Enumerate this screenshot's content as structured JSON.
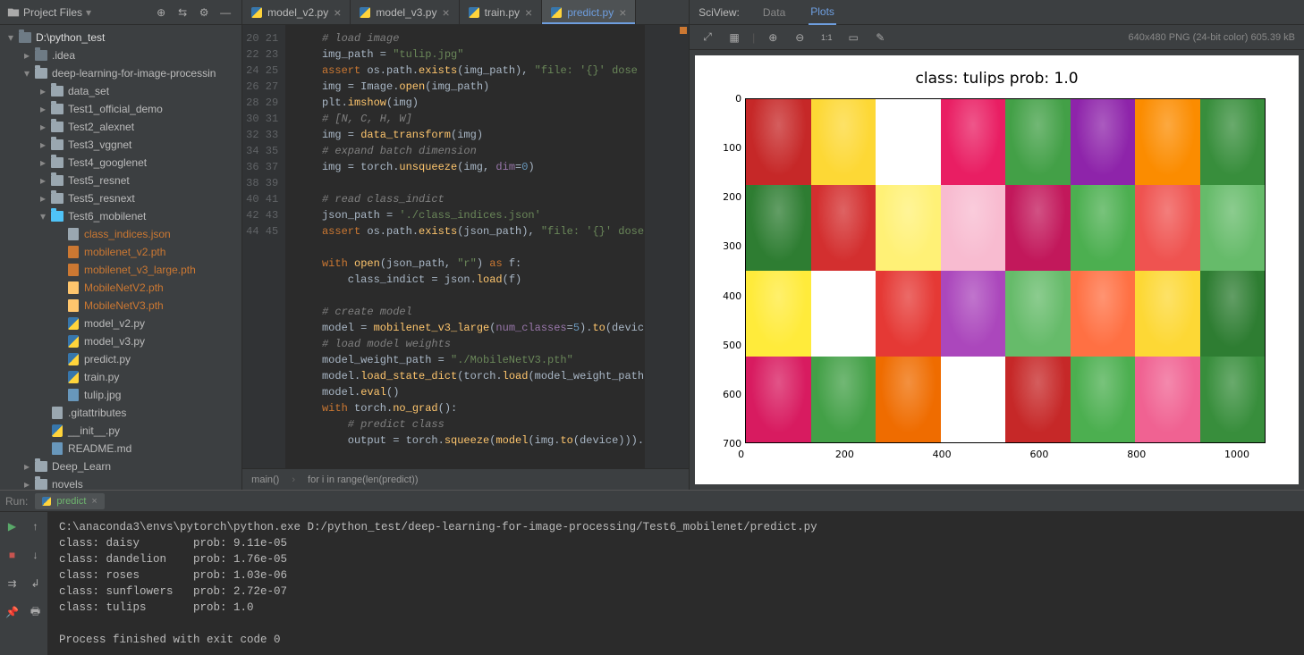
{
  "sidebar": {
    "title": "Project Files",
    "root": "D:\\python_test",
    "tree": [
      {
        "depth": 0,
        "chev": "down",
        "icon": "folder-dark",
        "label": "D:\\python_test",
        "cls": "root"
      },
      {
        "depth": 1,
        "chev": "right",
        "icon": "folder-dark",
        "label": ".idea"
      },
      {
        "depth": 1,
        "chev": "down",
        "icon": "folder",
        "label": "deep-learning-for-image-processin"
      },
      {
        "depth": 2,
        "chev": "right",
        "icon": "folder",
        "label": "data_set"
      },
      {
        "depth": 2,
        "chev": "right",
        "icon": "folder",
        "label": "Test1_official_demo"
      },
      {
        "depth": 2,
        "chev": "right",
        "icon": "folder",
        "label": "Test2_alexnet"
      },
      {
        "depth": 2,
        "chev": "right",
        "icon": "folder",
        "label": "Test3_vggnet"
      },
      {
        "depth": 2,
        "chev": "right",
        "icon": "folder",
        "label": "Test4_googlenet"
      },
      {
        "depth": 2,
        "chev": "right",
        "icon": "folder",
        "label": "Test5_resnet"
      },
      {
        "depth": 2,
        "chev": "right",
        "icon": "folder",
        "label": "Test5_resnext"
      },
      {
        "depth": 2,
        "chev": "down",
        "icon": "folder-cyan",
        "label": "Test6_mobilenet"
      },
      {
        "depth": 3,
        "chev": "none",
        "icon": "json",
        "label": "class_indices.json",
        "cls": "hl"
      },
      {
        "depth": 3,
        "chev": "none",
        "icon": "pth-orange",
        "label": "mobilenet_v2.pth",
        "cls": "hl"
      },
      {
        "depth": 3,
        "chev": "none",
        "icon": "pth-orange",
        "label": "mobilenet_v3_large.pth",
        "cls": "hl"
      },
      {
        "depth": 3,
        "chev": "none",
        "icon": "pth-hl",
        "label": "MobileNetV2.pth",
        "cls": "hl"
      },
      {
        "depth": 3,
        "chev": "none",
        "icon": "pth-hl",
        "label": "MobileNetV3.pth",
        "cls": "hl"
      },
      {
        "depth": 3,
        "chev": "none",
        "icon": "py",
        "label": "model_v2.py"
      },
      {
        "depth": 3,
        "chev": "none",
        "icon": "py",
        "label": "model_v3.py"
      },
      {
        "depth": 3,
        "chev": "none",
        "icon": "py",
        "label": "predict.py"
      },
      {
        "depth": 3,
        "chev": "none",
        "icon": "py",
        "label": "train.py"
      },
      {
        "depth": 3,
        "chev": "none",
        "icon": "jpg",
        "label": "tulip.jpg"
      },
      {
        "depth": 2,
        "chev": "none",
        "icon": "file",
        "label": ".gitattributes"
      },
      {
        "depth": 2,
        "chev": "none",
        "icon": "py",
        "label": "__init__.py"
      },
      {
        "depth": 2,
        "chev": "none",
        "icon": "md",
        "label": "README.md"
      },
      {
        "depth": 1,
        "chev": "right",
        "icon": "folder",
        "label": "Deep_Learn"
      },
      {
        "depth": 1,
        "chev": "right",
        "icon": "folder",
        "label": "novels"
      }
    ]
  },
  "tabs": [
    {
      "label": "model_v2.py"
    },
    {
      "label": "model_v3.py"
    },
    {
      "label": "train.py"
    },
    {
      "label": "predict.py",
      "active": true
    }
  ],
  "gutter_start": 20,
  "gutter_count": 26,
  "code_lines": [
    {
      "t": "    # load image",
      "c": "com"
    },
    {
      "t": "    img_path = \"tulip.jpg\"",
      "segs": [
        [
          "    img_path = ",
          ""
        ],
        [
          "\"tulip.jpg\"",
          "str"
        ]
      ]
    },
    {
      "segs": [
        [
          "    ",
          ""
        ],
        [
          "assert ",
          "kw"
        ],
        [
          "os.path.",
          ""
        ],
        [
          "exists",
          "fn"
        ],
        [
          "(img_path), ",
          ""
        ],
        [
          "\"file: '{}' dose",
          "str"
        ]
      ]
    },
    {
      "segs": [
        [
          "    img = Image.",
          ""
        ],
        [
          "open",
          "fn"
        ],
        [
          "(img_path)",
          ""
        ]
      ]
    },
    {
      "segs": [
        [
          "    plt.",
          ""
        ],
        [
          "imshow",
          "fn"
        ],
        [
          "(img)",
          ""
        ]
      ]
    },
    {
      "t": "    # [N, C, H, W]",
      "c": "com"
    },
    {
      "segs": [
        [
          "    img = ",
          ""
        ],
        [
          "data_transform",
          "fn"
        ],
        [
          "(img)",
          ""
        ]
      ]
    },
    {
      "t": "    # expand batch dimension",
      "c": "com"
    },
    {
      "segs": [
        [
          "    img = torch.",
          ""
        ],
        [
          "unsqueeze",
          "fn"
        ],
        [
          "(img, ",
          ""
        ],
        [
          "dim",
          "id"
        ],
        [
          "=",
          ""
        ],
        [
          "0",
          "num"
        ],
        [
          ")",
          ""
        ]
      ]
    },
    {
      "t": ""
    },
    {
      "t": "    # read class_indict",
      "c": "com"
    },
    {
      "segs": [
        [
          "    json_path = ",
          ""
        ],
        [
          "'./class_indices.json'",
          "str"
        ]
      ]
    },
    {
      "segs": [
        [
          "    ",
          ""
        ],
        [
          "assert ",
          "kw"
        ],
        [
          "os.path.",
          ""
        ],
        [
          "exists",
          "fn"
        ],
        [
          "(json_path), ",
          ""
        ],
        [
          "\"file: '{}' dose",
          "str"
        ]
      ]
    },
    {
      "t": ""
    },
    {
      "segs": [
        [
          "    ",
          ""
        ],
        [
          "with ",
          "kw"
        ],
        [
          "open",
          "fn"
        ],
        [
          "(json_path, ",
          ""
        ],
        [
          "\"r\"",
          "str"
        ],
        [
          ") ",
          ""
        ],
        [
          "as ",
          "kw"
        ],
        [
          "f:",
          ""
        ]
      ]
    },
    {
      "segs": [
        [
          "        class_indict = json.",
          ""
        ],
        [
          "load",
          "fn"
        ],
        [
          "(f)",
          ""
        ]
      ]
    },
    {
      "t": ""
    },
    {
      "t": "    # create model",
      "c": "com"
    },
    {
      "segs": [
        [
          "    model = ",
          ""
        ],
        [
          "mobilenet_v3_large",
          "fn"
        ],
        [
          "(",
          ""
        ],
        [
          "num_classes",
          "id"
        ],
        [
          "=",
          ""
        ],
        [
          "5",
          "num"
        ],
        [
          ").",
          ""
        ],
        [
          "to",
          "fn"
        ],
        [
          "(devic",
          ""
        ]
      ]
    },
    {
      "t": "    # load model weights",
      "c": "com"
    },
    {
      "segs": [
        [
          "    model_weight_path = ",
          ""
        ],
        [
          "\"./MobileNetV3.pth\"",
          "str"
        ]
      ]
    },
    {
      "segs": [
        [
          "    model.",
          ""
        ],
        [
          "load_state_dict",
          "fn"
        ],
        [
          "(torch.",
          ""
        ],
        [
          "load",
          "fn"
        ],
        [
          "(model_weight_path",
          ""
        ]
      ]
    },
    {
      "segs": [
        [
          "    model.",
          ""
        ],
        [
          "eval",
          "fn"
        ],
        [
          "()",
          ""
        ]
      ]
    },
    {
      "segs": [
        [
          "    ",
          ""
        ],
        [
          "with ",
          "kw"
        ],
        [
          "torch.",
          ""
        ],
        [
          "no_grad",
          "fn"
        ],
        [
          "():",
          ""
        ]
      ]
    },
    {
      "t": "        # predict class",
      "c": "com"
    },
    {
      "segs": [
        [
          "        output = torch.",
          ""
        ],
        [
          "squeeze",
          "fn"
        ],
        [
          "(",
          ""
        ],
        [
          "model",
          "fn"
        ],
        [
          "(img.",
          ""
        ],
        [
          "to",
          "fn"
        ],
        [
          "(device))).",
          ""
        ]
      ]
    }
  ],
  "breadcrumb": [
    "main()",
    "for i in range(len(predict))"
  ],
  "sciview": {
    "title": "SciView:",
    "data_tab": "Data",
    "plots_tab": "Plots",
    "plot_info": "640x480 PNG (24-bit color) 605.39 kB",
    "plot_title": "class: tulips   prob: 1.0",
    "xaxis": [
      "0",
      "200",
      "400",
      "600",
      "800",
      "1000"
    ],
    "yaxis": [
      "0",
      "100",
      "200",
      "300",
      "400",
      "500",
      "600",
      "700"
    ]
  },
  "chart_data": {
    "type": "image-plot",
    "title": "class: tulips   prob: 1.0",
    "xlim": [
      0,
      1070
    ],
    "ylim": [
      0,
      720
    ],
    "xticks": [
      0,
      200,
      400,
      600,
      800,
      1000
    ],
    "yticks": [
      0,
      100,
      200,
      300,
      400,
      500,
      600,
      700
    ],
    "image_description": "photograph of a field of multi-colored tulips (red, white, yellow, pink, orange, purple) with green stems and leaves"
  },
  "run": {
    "label": "Run:",
    "tab": "predict",
    "lines": [
      "C:\\anaconda3\\envs\\pytorch\\python.exe D:/python_test/deep-learning-for-image-processing/Test6_mobilenet/predict.py",
      "class: daisy        prob: 9.11e-05",
      "class: dandelion    prob: 1.76e-05",
      "class: roses        prob: 1.03e-06",
      "class: sunflowers   prob: 2.72e-07",
      "class: tulips       prob: 1.0",
      "",
      "Process finished with exit code 0"
    ]
  }
}
